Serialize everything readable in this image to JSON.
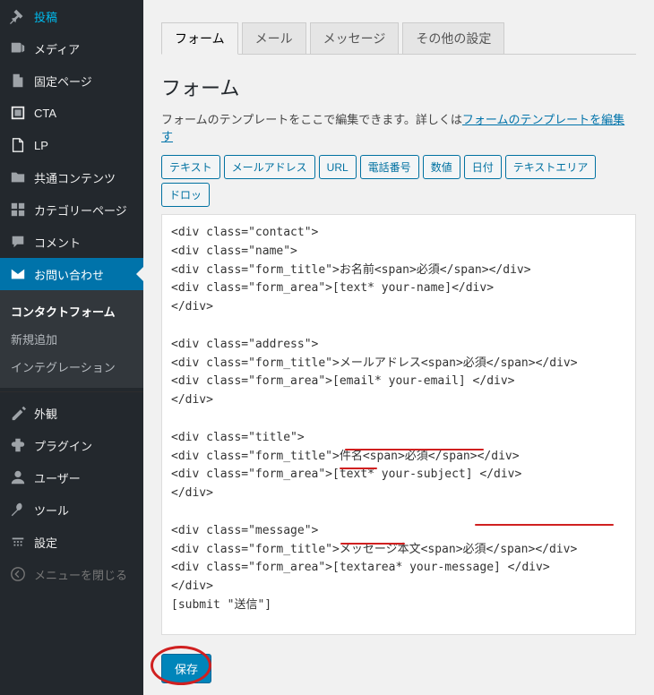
{
  "sidebar": {
    "items": [
      {
        "label": "投稿",
        "icon": "pin"
      },
      {
        "label": "メディア",
        "icon": "media"
      },
      {
        "label": "固定ページ",
        "icon": "page"
      },
      {
        "label": "CTA",
        "icon": "cta"
      },
      {
        "label": "LP",
        "icon": "lp"
      },
      {
        "label": "共通コンテンツ",
        "icon": "folder"
      },
      {
        "label": "カテゴリーページ",
        "icon": "category"
      },
      {
        "label": "コメント",
        "icon": "comment"
      },
      {
        "label": "お問い合わせ",
        "icon": "mail",
        "active": true
      }
    ],
    "submenu": [
      {
        "label": "コンタクトフォーム",
        "current": true
      },
      {
        "label": "新規追加"
      },
      {
        "label": "インテグレーション"
      }
    ],
    "bottom": [
      {
        "label": "外観",
        "icon": "appearance"
      },
      {
        "label": "プラグイン",
        "icon": "plugin"
      },
      {
        "label": "ユーザー",
        "icon": "user"
      },
      {
        "label": "ツール",
        "icon": "tool"
      },
      {
        "label": "設定",
        "icon": "settings"
      }
    ],
    "collapse": "メニューを閉じる"
  },
  "tabs": [
    "フォーム",
    "メール",
    "メッセージ",
    "その他の設定"
  ],
  "panel": {
    "title": "フォーム",
    "desc_prefix": "フォームのテンプレートをここで編集できます。詳しくは",
    "desc_link": "フォームのテンプレートを編集す",
    "tag_buttons": [
      "テキスト",
      "メールアドレス",
      "URL",
      "電話番号",
      "数値",
      "日付",
      "テキストエリア",
      "ドロッ"
    ],
    "textarea": "<div class=\"contact\">\n<div class=\"name\">\n<div class=\"form_title\">お名前<span>必須</span></div>\n<div class=\"form_area\">[text* your-name]</div>\n</div>\n\n<div class=\"address\">\n<div class=\"form_title\">メールアドレス<span>必須</span></div>\n<div class=\"form_area\">[email* your-email] </div>\n</div>\n\n<div class=\"title\">\n<div class=\"form_title\">件名<span>必須</span></div>\n<div class=\"form_area\">[text* your-subject] </div>\n</div>\n\n<div class=\"message\">\n<div class=\"form_title\">メッセージ本文<span>必須</span></div>\n<div class=\"form_area\">[textarea* your-message] </div>\n</div>\n[submit \"送信\"]\n\n</div>",
    "save": "保存"
  }
}
